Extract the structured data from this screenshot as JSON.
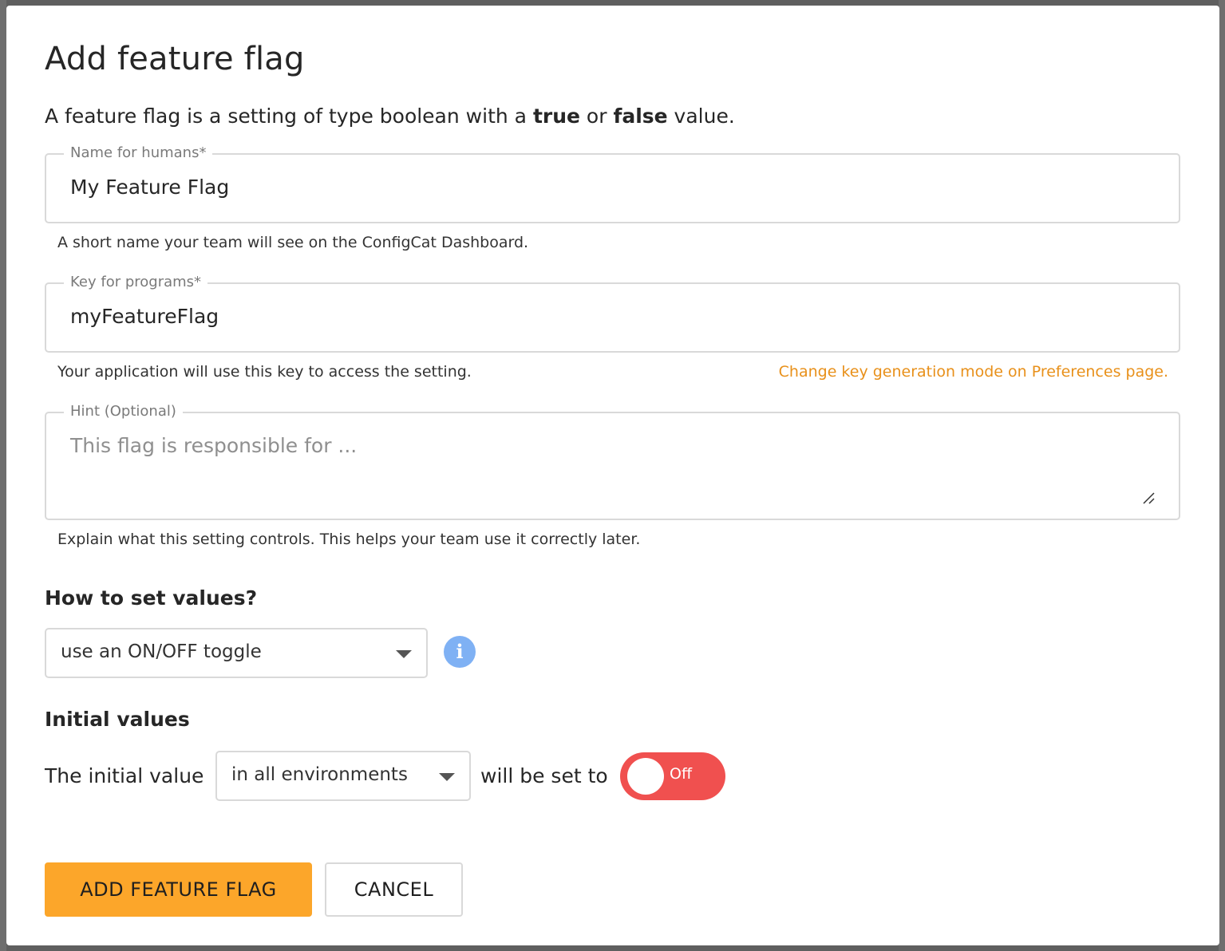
{
  "dialog": {
    "title": "Add feature flag",
    "intro_prefix": "A feature flag is a setting of type boolean with a ",
    "intro_true": "true",
    "intro_or": " or ",
    "intro_false": "false",
    "intro_suffix": " value."
  },
  "name_field": {
    "legend": "Name for humans*",
    "value": "My Feature Flag",
    "helper": "A short name your team will see on the ConfigCat Dashboard."
  },
  "key_field": {
    "legend": "Key for programs*",
    "value": "myFeatureFlag",
    "helper": "Your application will use this key to access the setting.",
    "link": "Change key generation mode on Preferences page."
  },
  "hint_field": {
    "legend": "Hint (Optional)",
    "placeholder": "This flag is responsible for ...",
    "helper": "Explain what this setting controls. This helps your team use it correctly later."
  },
  "values_section": {
    "heading": "How to set values?",
    "selected": "use an ON/OFF toggle",
    "info_icon": "i"
  },
  "initial_section": {
    "heading": "Initial values",
    "prefix": "The initial value",
    "env_selected": "in all environments",
    "middle": "will be set to",
    "toggle_label": "Off",
    "toggle_color": "#f0504f"
  },
  "actions": {
    "primary": "ADD FEATURE FLAG",
    "secondary": "CANCEL",
    "primary_color": "#fca62a"
  }
}
